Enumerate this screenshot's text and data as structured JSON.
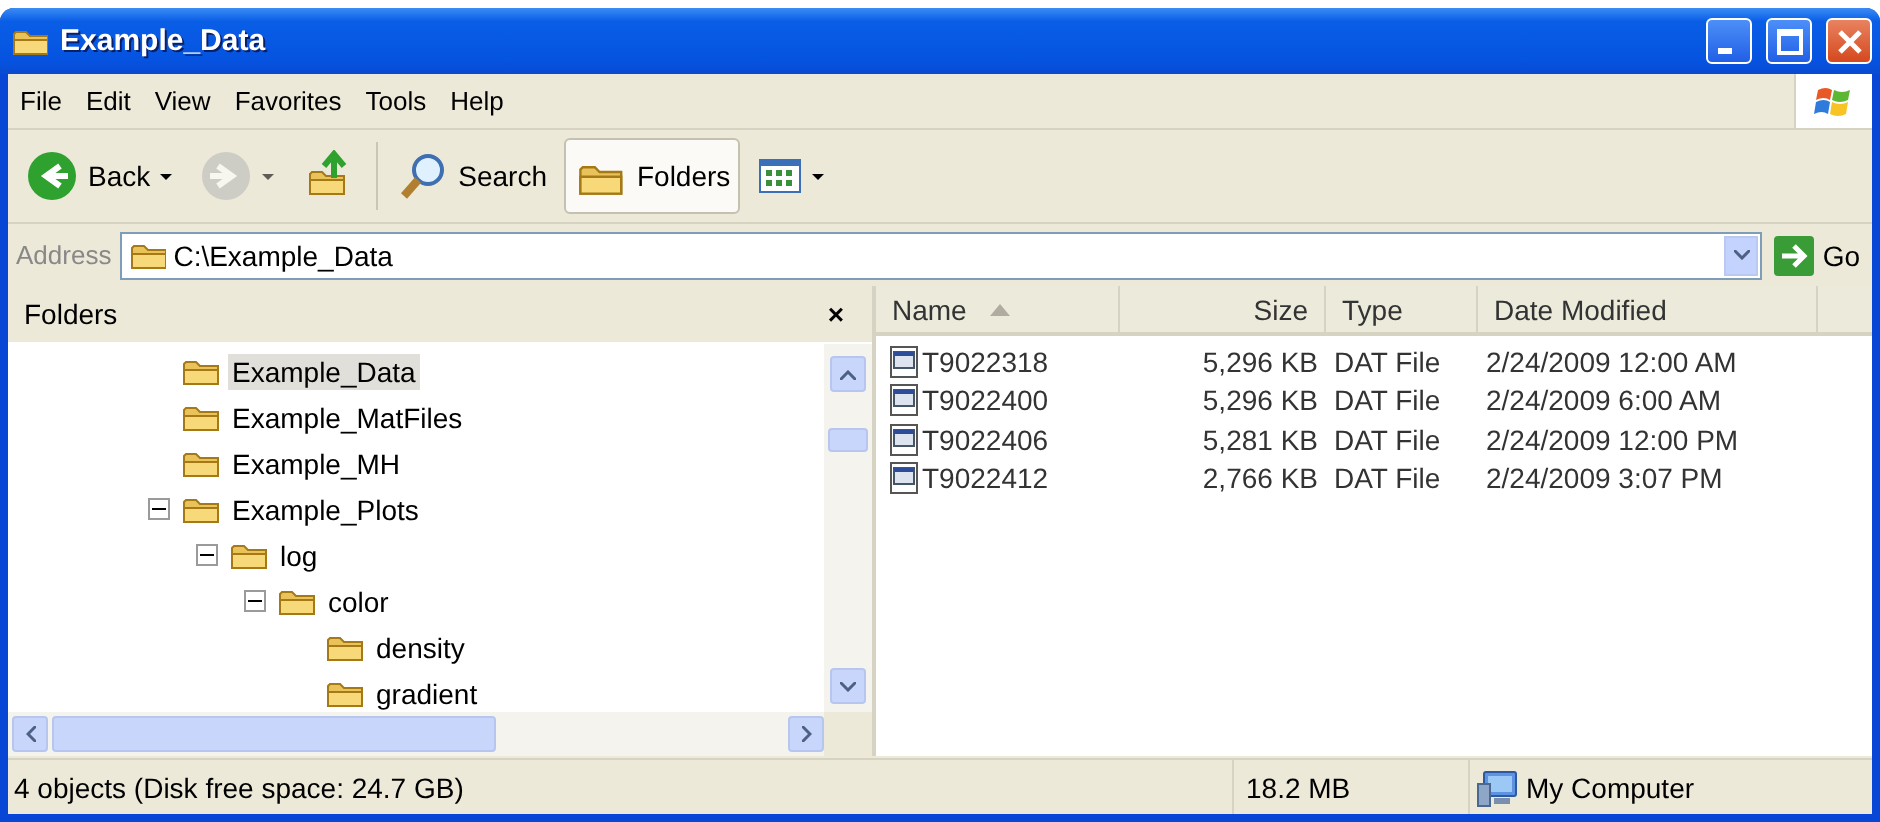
{
  "window": {
    "title": "Example_Data"
  },
  "menu": [
    "File",
    "Edit",
    "View",
    "Favorites",
    "Tools",
    "Help"
  ],
  "toolbar": [
    {
      "kind": "back",
      "label": "Back",
      "disabled": false,
      "pressed": false
    },
    {
      "kind": "forward",
      "disabled": true,
      "pressed": false
    },
    {
      "kind": "up",
      "disabled": false,
      "pressed": false
    },
    {
      "kind": "search",
      "label": "Search",
      "disabled": false,
      "pressed": false
    },
    {
      "kind": "folders",
      "label": "Folders",
      "disabled": false,
      "pressed": true
    },
    {
      "kind": "views",
      "disabled": false,
      "pressed": false
    }
  ],
  "address": {
    "label": "Address",
    "value": "C:\\Example_Data",
    "go": "Go"
  },
  "folders_pane": {
    "title": "Folders",
    "close": "×",
    "tree": [
      {
        "label": "Example_Data",
        "selected": true
      },
      {
        "label": "Example_MatFiles",
        "selected": false
      },
      {
        "label": "Example_MH",
        "selected": false
      },
      {
        "label": "Example_Plots",
        "selected": false,
        "expanded": true,
        "children": [
          {
            "label": "log",
            "selected": false,
            "expanded": true,
            "children": [
              {
                "label": "color",
                "selected": false,
                "expanded": true,
                "children": [
                  {
                    "label": "density",
                    "selected": false
                  },
                  {
                    "label": "gradient",
                    "selected": false
                  }
                ]
              }
            ]
          }
        ]
      }
    ]
  },
  "file_list": {
    "columns": [
      {
        "label": "Name",
        "sorted": true
      },
      {
        "label": "Size",
        "sorted": false
      },
      {
        "label": "Type",
        "sorted": false
      },
      {
        "label": "Date Modified",
        "sorted": false
      }
    ],
    "rows": [
      {
        "name": "T9022318",
        "size": "5,296 KB",
        "type": "DAT File",
        "date": "2/24/2009 12:00 AM"
      },
      {
        "name": "T9022400",
        "size": "5,296 KB",
        "type": "DAT File",
        "date": "2/24/2009 6:00 AM"
      },
      {
        "name": "T9022406",
        "size": "5,281 KB",
        "type": "DAT File",
        "date": "2/24/2009 12:00 PM"
      },
      {
        "name": "T9022412",
        "size": "2,766 KB",
        "type": "DAT File",
        "date": "2/24/2009 3:07 PM"
      }
    ]
  },
  "status_bar": {
    "text": "4 objects (Disk free space: 24.7 GB)",
    "size": "18.2 MB",
    "zone": "My Computer"
  }
}
